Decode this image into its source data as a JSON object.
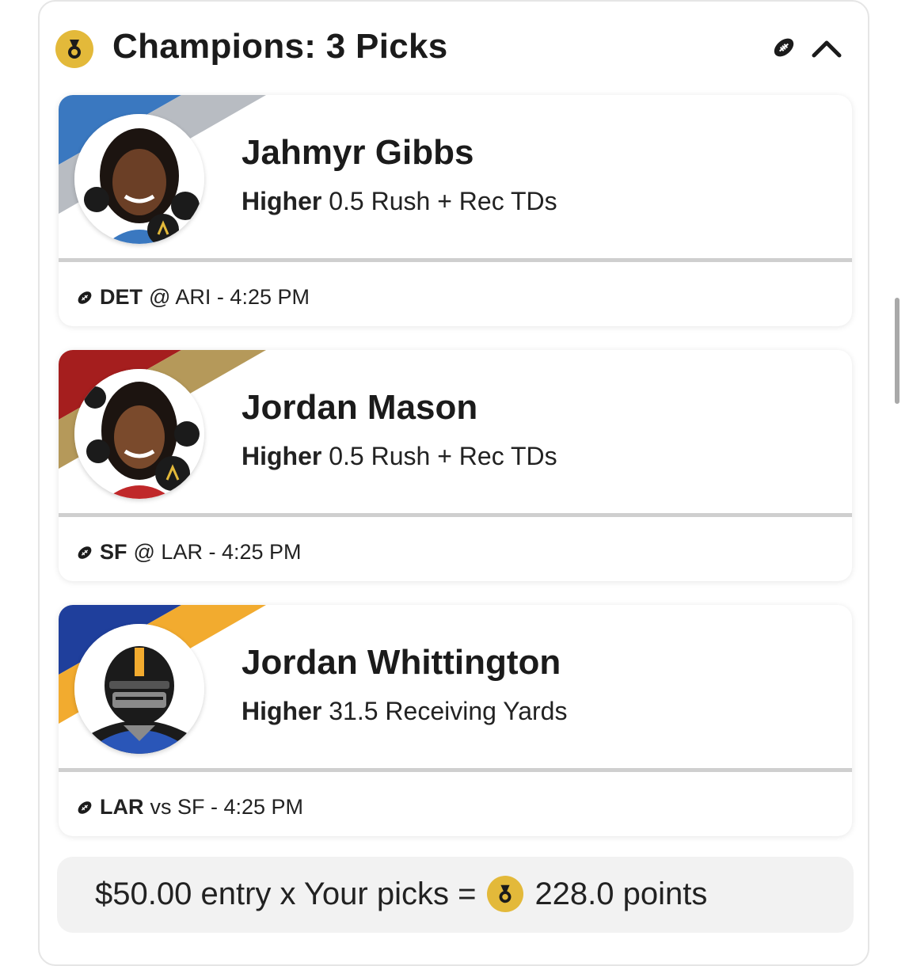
{
  "header": {
    "title": "Champions: 3 Picks",
    "medal_icon": "medal-icon",
    "ball_icon": "football-icon",
    "collapse_icon": "chevron-up-icon"
  },
  "picks": [
    {
      "player": "Jahmyr Gibbs",
      "direction": "Higher",
      "line": "0.5 Rush + Rec TDs",
      "team": "DET",
      "matchup": "@ ARI - 4:25 PM",
      "colors": [
        "#3a78c0",
        "#b8bcc2"
      ]
    },
    {
      "player": "Jordan Mason",
      "direction": "Higher",
      "line": "0.5 Rush + Rec TDs",
      "team": "SF",
      "matchup": "@ LAR - 4:25 PM",
      "colors": [
        "#a51e1e",
        "#b5995a"
      ]
    },
    {
      "player": "Jordan Whittington",
      "direction": "Higher",
      "line": "31.5 Receiving Yards",
      "team": "LAR",
      "matchup": "vs SF - 4:25 PM",
      "colors": [
        "#1f3f9c",
        "#f2ab2f"
      ]
    }
  ],
  "summary": {
    "prefix": "$50.00 entry x Your picks =",
    "points": "228.0 points"
  }
}
